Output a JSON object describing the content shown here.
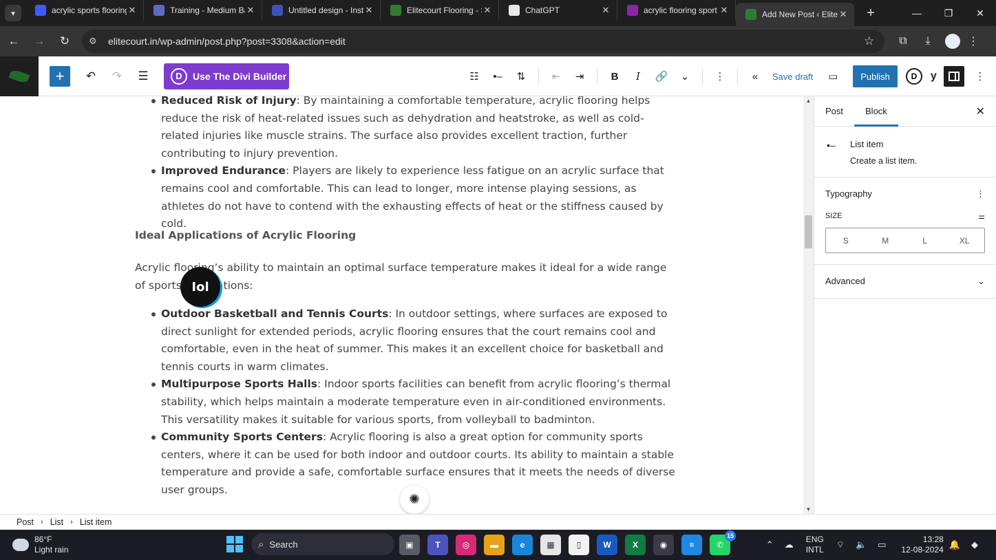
{
  "browser": {
    "tabs": [
      {
        "title": "acrylic sports flooring",
        "fav": "#3d5afe"
      },
      {
        "title": "Training - Medium Ba",
        "fav": "#5c6bc0"
      },
      {
        "title": "Untitled design - Inst",
        "fav": "#3f51b5"
      },
      {
        "title": "Elitecourt Flooring - S",
        "fav": "#2e7d32"
      },
      {
        "title": "ChatGPT",
        "fav": "#e8e8e8"
      },
      {
        "title": "acrylic flooring sport",
        "fav": "#8e24aa"
      },
      {
        "title": "Add New Post ‹ Elite",
        "fav": "#2e7d32"
      }
    ],
    "close_glyph": "✕",
    "new_tab_glyph": "+",
    "url": "elitecourt.in/wp-admin/post.php?post=3308&action=edit"
  },
  "editor": {
    "divi_label": "Use The Divi Builder",
    "divi_letter": "D",
    "save_draft": "Save draft",
    "publish": "Publish",
    "divi_circle": "D",
    "yoast": "y"
  },
  "content": {
    "list1": [
      {
        "bold": "Reduced Risk of Injury",
        "text": ": By maintaining a comfortable temperature, acrylic flooring helps reduce the risk of heat-related issues such as dehydration and heatstroke, as well as cold-related injuries like muscle strains. The surface also provides excellent traction, further contributing to injury prevention."
      },
      {
        "bold": "Improved Endurance",
        "text": ": Players are likely to experience less fatigue on an acrylic surface that remains cool and comfortable. This can lead to longer, more intense playing sessions, as athletes do not have to contend with the exhausting effects of heat or the stiffness caused by cold."
      }
    ],
    "heading": "Ideal Applications of Acrylic Flooring",
    "paragraph": "Acrylic flooring’s ability to maintain an optimal surface temperature makes it ideal for a wide range of sports applications:",
    "list2": [
      {
        "bold": "Outdoor Basketball and Tennis Courts",
        "text": ": In outdoor settings, where surfaces are exposed to direct sunlight for extended periods, acrylic flooring ensures that the court remains cool and comfortable, even in the heat of summer. This makes it an excellent choice for basketball and tennis courts in warm climates."
      },
      {
        "bold": "Multipurpose Sports Halls",
        "text": ": Indoor sports facilities can benefit from acrylic flooring’s thermal stability, which helps maintain a moderate temperature even in air-conditioned environments. This versatility makes it suitable for various sports, from volleyball to badminton."
      },
      {
        "bold": "Community Sports Centers",
        "text": ": Acrylic flooring is also a great option for community sports centers, where it can be used for both indoor and outdoor courts. Its ability to maintain a stable temperature and provide a safe, comfortable surface ensures that it meets the needs of diverse user groups."
      }
    ],
    "avatar_text": "Iol"
  },
  "sidebar": {
    "tab_post": "Post",
    "tab_block": "Block",
    "block_name": "List item",
    "block_desc": "Create a list item.",
    "typography": "Typography",
    "size_label": "SIZE",
    "sizes": [
      "S",
      "M",
      "L",
      "XL"
    ],
    "advanced": "Advanced"
  },
  "breadcrumb": [
    "Post",
    "List",
    "List item"
  ],
  "taskbar": {
    "temp": "86°F",
    "condition": "Light rain",
    "search": "Search",
    "lang1": "ENG",
    "lang2": "INTL",
    "time": "13:28",
    "date": "12-08-2024",
    "whatsapp_badge": "15"
  }
}
